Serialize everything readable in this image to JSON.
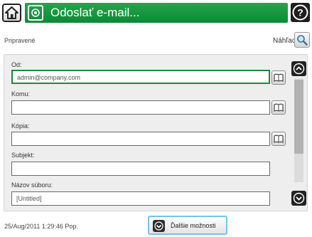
{
  "header": {
    "title": "Odoslať e-mail...",
    "home_icon": "home-icon",
    "email_icon": "email-icon",
    "help_icon": "help-icon"
  },
  "status": {
    "text": "Pripravené",
    "preview_label": "Náhľad",
    "preview_icon": "magnifier-icon"
  },
  "form": {
    "fields": [
      {
        "label": "Od:",
        "value": "admin@company.com"
      },
      {
        "label": "Komu:",
        "value": ""
      },
      {
        "label": "Kópia:",
        "value": ""
      },
      {
        "label": "Subjekt:",
        "value": ""
      },
      {
        "label": "Názov súboru:",
        "value": "[Untitled]"
      }
    ]
  },
  "footer": {
    "datetime": "25/Aug/2011 1:29:46 Pop.",
    "more_options_label": "Ďalšie možnosti"
  },
  "colors": {
    "title_bar": "#1a9a42",
    "active_field_border": "#1b8a3c",
    "more_button_border": "#77c4e6"
  }
}
